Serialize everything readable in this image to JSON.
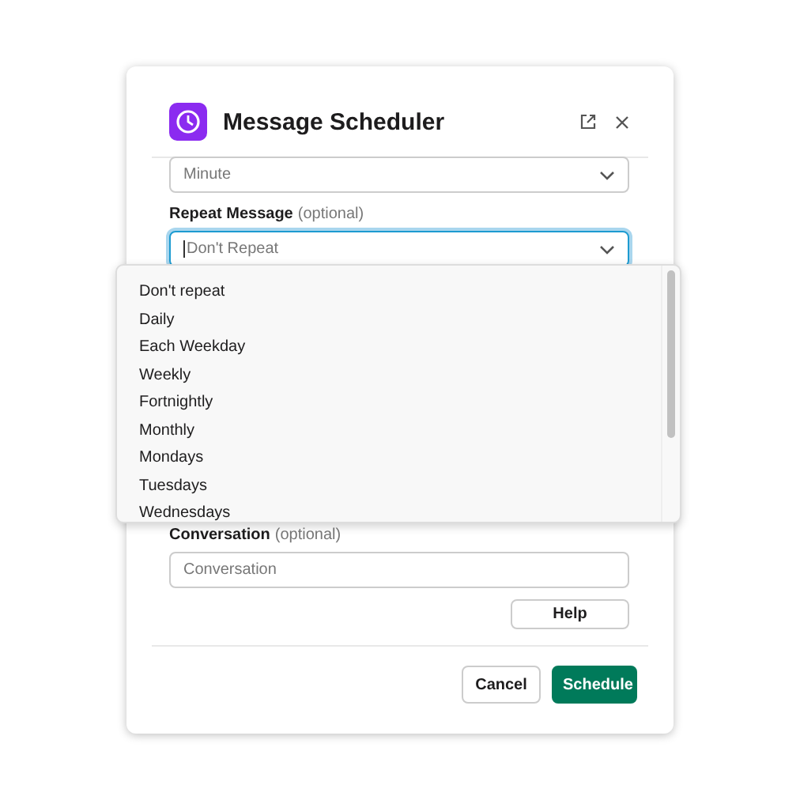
{
  "dialog": {
    "title": "Message Scheduler"
  },
  "fields": [
    {
      "kind": "select",
      "value": "Minute",
      "focused": false
    },
    {
      "kind": "select",
      "label": "Repeat Message",
      "hint": "(optional)",
      "placeholder": "Don't Repeat",
      "focused": true,
      "options": [
        "Don't repeat",
        "Daily",
        "Each Weekday",
        "Weekly",
        "Fortnightly",
        "Monthly",
        "Mondays",
        "Tuesdays",
        "Wednesdays"
      ]
    },
    {
      "kind": "text",
      "label": "Conversation",
      "hint": "(optional)",
      "placeholder": "Conversation",
      "focused": false
    }
  ],
  "help_button": "Help",
  "buttons": [
    {
      "label": "Cancel",
      "kind": "secondary"
    },
    {
      "label": "Schedule",
      "kind": "primary"
    }
  ]
}
